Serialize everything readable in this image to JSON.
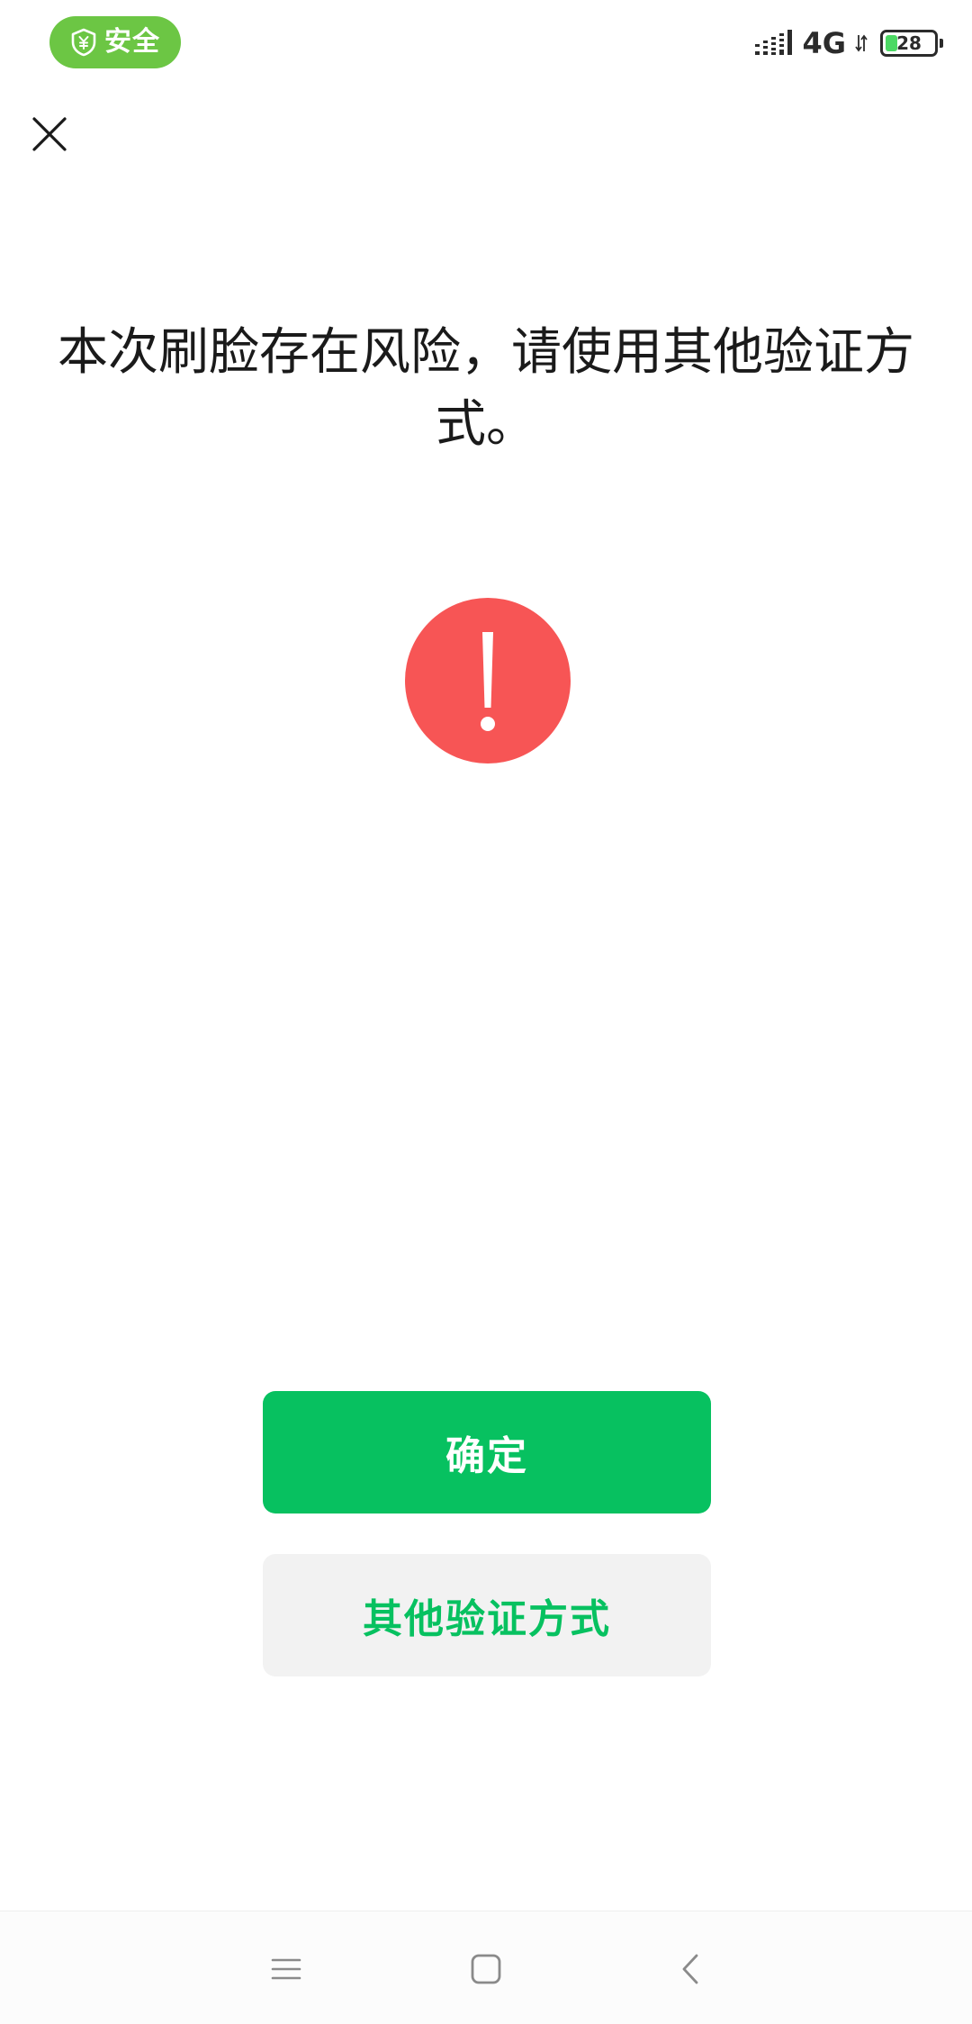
{
  "status_bar": {
    "security_label": "安全",
    "network": "4G",
    "battery_level": "28",
    "icons": {
      "shield": "shield-yuan-icon",
      "signal": "signal-icon",
      "transfer": "data-transfer-icon",
      "battery": "battery-icon"
    }
  },
  "header": {
    "close_icon": "close-icon"
  },
  "main": {
    "message": "本次刷脸存在风险，请使用其他验证方式。",
    "warning_icon": "exclamation-circle-icon",
    "warning_color": "#f75555"
  },
  "actions": {
    "confirm_label": "确定",
    "other_method_label": "其他验证方式",
    "primary_color": "#07c160",
    "secondary_bg": "#f2f2f2"
  },
  "nav_bar": {
    "menu_icon": "menu-icon",
    "home_icon": "home-square-icon",
    "back_icon": "back-chevron-icon"
  },
  "colors": {
    "security_pill": "#6cc644",
    "battery_fill": "#4cd964"
  }
}
